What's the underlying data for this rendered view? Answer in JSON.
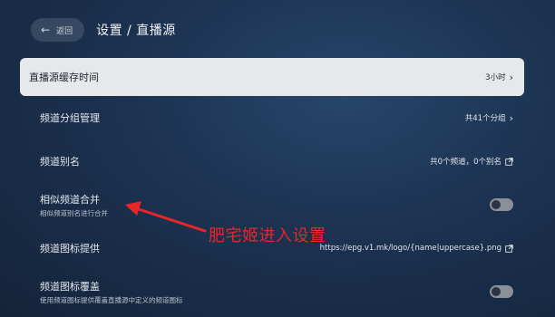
{
  "header": {
    "back_label": "返回",
    "title": "设置 / 直播源"
  },
  "settings": [
    {
      "label": "直播源缓存时间",
      "value": "3小时",
      "control": "chevron",
      "active": true
    },
    {
      "label": "频道分组管理",
      "value": "共41个分组",
      "control": "chevron"
    },
    {
      "label": "频道别名",
      "value": "共0个频道，0个别名",
      "control": "external"
    },
    {
      "label": "相似频道合并",
      "sub": "相似频道别名进行合并",
      "control": "toggle",
      "enabled": false
    },
    {
      "label": "频道图标提供",
      "value": "https://epg.v1.mk/logo/{name|uppercase}.png",
      "control": "external"
    },
    {
      "label": "频道图标覆盖",
      "sub": "使用频道图标提供覆盖直播源中定义的频道图标",
      "control": "toggle",
      "enabled": false
    }
  ],
  "annotation": {
    "text": "肥宅姬进入设置",
    "color": "#e8262a"
  },
  "icons": {
    "back": "arrow-left-icon",
    "chevron": "chevron-right-icon",
    "external": "external-link-icon"
  }
}
